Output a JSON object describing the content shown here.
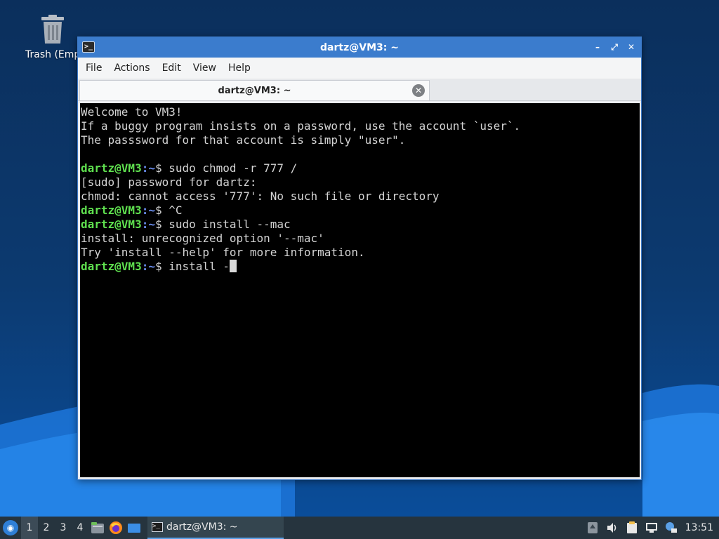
{
  "desktop": {
    "trash_label": "Trash (Empty)"
  },
  "window": {
    "title": "dartz@VM3: ~",
    "menu": [
      "File",
      "Actions",
      "Edit",
      "View",
      "Help"
    ],
    "tab_title": "dartz@VM3: ~",
    "controls": {
      "minimize": "–",
      "maximize": "⤢",
      "close": "✕"
    }
  },
  "terminal": {
    "lines": [
      {
        "type": "text",
        "text": "Welcome to VM3!"
      },
      {
        "type": "text",
        "text": "If a buggy program insists on a password, use the account `user`."
      },
      {
        "type": "text",
        "text": "The passsword for that account is simply \"user\"."
      },
      {
        "type": "text",
        "text": ""
      },
      {
        "type": "prompt",
        "user": "dartz@VM3",
        "path": ":~",
        "cmd": "$ sudo chmod -r 777 /"
      },
      {
        "type": "text",
        "text": "[sudo] password for dartz:"
      },
      {
        "type": "text",
        "text": "chmod: cannot access '777': No such file or directory"
      },
      {
        "type": "prompt",
        "user": "dartz@VM3",
        "path": ":~",
        "cmd": "$ ^C"
      },
      {
        "type": "prompt",
        "user": "dartz@VM3",
        "path": ":~",
        "cmd": "$ sudo install --mac"
      },
      {
        "type": "text",
        "text": "install: unrecognized option '--mac'"
      },
      {
        "type": "text",
        "text": "Try 'install --help' for more information."
      },
      {
        "type": "prompt",
        "user": "dartz@VM3",
        "path": ":~",
        "cmd": "$ install -",
        "cursor": true
      }
    ],
    "colors": {
      "user": "#5fe04f",
      "path": "#6b8ef0",
      "text": "#d4d4d4",
      "bg": "#000000"
    }
  },
  "taskbar": {
    "workspaces": [
      "1",
      "2",
      "3",
      "4"
    ],
    "active_workspace": "1",
    "task_label": "dartz@VM3: ~",
    "clock": "13:51",
    "accent": "#3b7ccd"
  }
}
